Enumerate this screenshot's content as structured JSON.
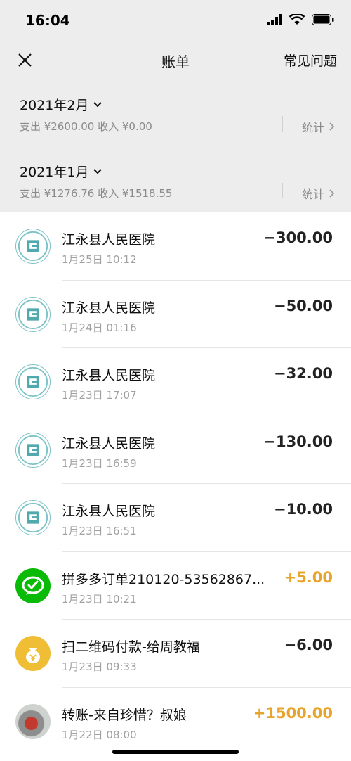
{
  "status": {
    "time": "16:04"
  },
  "nav": {
    "title": "账单",
    "faq": "常见问题"
  },
  "months": [
    {
      "title": "2021年2月",
      "summary": "支出 ¥2600.00 收入 ¥0.00",
      "stat": "统计"
    },
    {
      "title": "2021年1月",
      "summary": "支出 ¥1276.76 收入 ¥1518.55",
      "stat": "统计"
    }
  ],
  "transactions": [
    {
      "name": "江永县人民医院",
      "time": "1月25日 10:12",
      "amount": "−300.00",
      "icon": "hospital-logo-icon"
    },
    {
      "name": "江永县人民医院",
      "time": "1月24日 01:16",
      "amount": "−50.00",
      "icon": "hospital-logo-icon"
    },
    {
      "name": "江永县人民医院",
      "time": "1月23日 17:07",
      "amount": "−32.00",
      "icon": "hospital-logo-icon"
    },
    {
      "name": "江永县人民医院",
      "time": "1月23日 16:59",
      "amount": "−130.00",
      "icon": "hospital-logo-icon"
    },
    {
      "name": "江永县人民医院",
      "time": "1月23日 16:51",
      "amount": "−10.00",
      "icon": "hospital-logo-icon"
    },
    {
      "name": "拼多多订单210120-53562867...",
      "time": "1月23日 10:21",
      "amount": "+5.00",
      "icon": "wechat-pay-icon"
    },
    {
      "name": "扫二维码付款-给周教福",
      "time": "1月23日 09:33",
      "amount": "−6.00",
      "icon": "money-bag-icon"
    },
    {
      "name": "转账-来自珍惜？叔娘",
      "time": "1月22日 08:00",
      "amount": "+1500.00",
      "icon": "user-photo-avatar"
    }
  ],
  "colors": {
    "income": "#e7a42d",
    "background": "#ededed",
    "wechat_green": "#09bb07",
    "money_yellow": "#f0be34"
  }
}
